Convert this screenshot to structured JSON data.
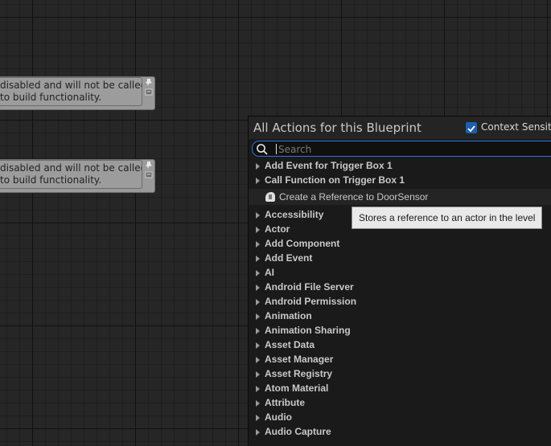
{
  "comments": [
    {
      "line1": "disabled and will not be called.",
      "line2": "to build functionality."
    },
    {
      "line1": "disabled and will not be called.",
      "line2": "to build functionality."
    }
  ],
  "menu": {
    "title": "All Actions for this Blueprint",
    "context_label": "Context Sensitive",
    "context_checked": true,
    "search_placeholder": "Search",
    "top_items": [
      {
        "label": "Add Event for Trigger Box 1"
      },
      {
        "label": "Call Function on Trigger Box 1"
      }
    ],
    "reference_item": "Create a Reference to DoorSensor",
    "categories": [
      {
        "label": "Accessibility"
      },
      {
        "label": "Actor"
      },
      {
        "label": "Add Component"
      },
      {
        "label": "Add Event"
      },
      {
        "label": "AI"
      },
      {
        "label": "Android File Server"
      },
      {
        "label": "Android Permission"
      },
      {
        "label": "Animation"
      },
      {
        "label": "Animation Sharing"
      },
      {
        "label": "Asset Data"
      },
      {
        "label": "Asset Manager"
      },
      {
        "label": "Asset Registry"
      },
      {
        "label": "Atom Material"
      },
      {
        "label": "Attribute"
      },
      {
        "label": "Audio"
      },
      {
        "label": "Audio Capture"
      }
    ]
  },
  "tooltip": "Stores a reference to an actor in the level",
  "colors": {
    "accent": "#2a78d6",
    "checkbox": "#1e5fb0"
  }
}
